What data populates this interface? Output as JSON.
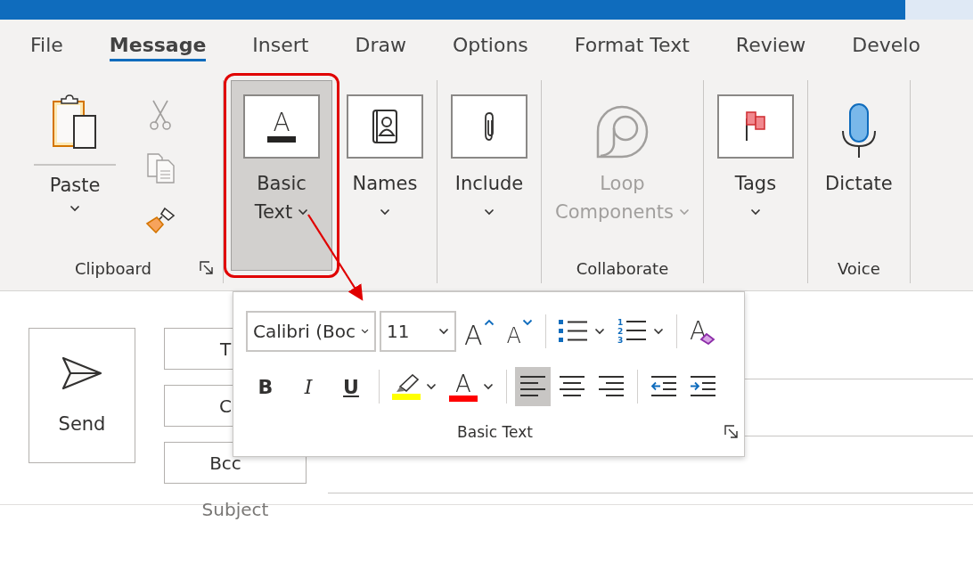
{
  "tabs": [
    {
      "label": "File",
      "selected": false
    },
    {
      "label": "Message",
      "selected": true
    },
    {
      "label": "Insert",
      "selected": false
    },
    {
      "label": "Draw",
      "selected": false
    },
    {
      "label": "Options",
      "selected": false
    },
    {
      "label": "Format Text",
      "selected": false
    },
    {
      "label": "Review",
      "selected": false
    },
    {
      "label": "Develo",
      "selected": false
    }
  ],
  "ribbon": {
    "groups": [
      {
        "kind": "clipboard",
        "label": "Clipboard",
        "launcher": true,
        "paste": "Paste"
      },
      {
        "kind": "large",
        "buttons": [
          {
            "kind": "font",
            "glyph": "A",
            "lines": [
              "Basic",
              "Text"
            ],
            "dropdown": true,
            "selected": true,
            "outlined": true,
            "disabled": false
          },
          {
            "kind": "contacts",
            "lines": [
              "Names"
            ],
            "dropdown": true,
            "selected": false,
            "disabled": false
          }
        ]
      },
      {
        "kind": "large",
        "buttons": [
          {
            "kind": "paperclip",
            "lines": [
              "Include"
            ],
            "dropdown": true,
            "selected": false,
            "disabled": false
          }
        ]
      },
      {
        "kind": "large",
        "label": "Collaborate",
        "buttons": [
          {
            "kind": "loop",
            "lines": [
              "Loop",
              "Components"
            ],
            "dropdown": true,
            "selected": false,
            "disabled": true
          }
        ]
      },
      {
        "kind": "large",
        "buttons": [
          {
            "kind": "flag",
            "lines": [
              "Tags"
            ],
            "dropdown": true,
            "selected": false,
            "disabled": false
          }
        ]
      },
      {
        "kind": "large",
        "label": "Voice",
        "buttons": [
          {
            "kind": "mic",
            "lines": [
              "Dictate"
            ],
            "dropdown": false,
            "selected": false,
            "disabled": false
          }
        ]
      }
    ]
  },
  "basic_text_panel": {
    "title": "Basic Text",
    "launcher": true,
    "font_row": [
      {
        "kind": "font-combo",
        "value": "Calibri (Boc"
      },
      {
        "kind": "size-combo",
        "value": "11"
      },
      {
        "kind": "grow",
        "glyph": "A"
      },
      {
        "kind": "shrink",
        "glyph": "A"
      },
      {
        "kind": "separator"
      },
      {
        "kind": "bullets",
        "dropdown": true
      },
      {
        "kind": "numbering",
        "numbers": [
          "1",
          "2",
          "3"
        ],
        "dropdown": true
      },
      {
        "kind": "separator"
      },
      {
        "kind": "clear",
        "glyph": "A"
      }
    ],
    "format_row": [
      {
        "kind": "text-style",
        "label": "B"
      },
      {
        "kind": "text-style",
        "label": "I"
      },
      {
        "kind": "text-style",
        "label": "U"
      },
      {
        "kind": "separator"
      },
      {
        "kind": "highlight",
        "color": "#ffff00",
        "dropdown": true
      },
      {
        "kind": "font-color",
        "glyph": "A",
        "color": "#ff0000",
        "dropdown": true
      },
      {
        "kind": "separator"
      },
      {
        "kind": "align-left",
        "selected": true
      },
      {
        "kind": "align-center",
        "selected": false
      },
      {
        "kind": "align-right",
        "selected": false
      },
      {
        "kind": "separator"
      },
      {
        "kind": "outdent"
      },
      {
        "kind": "indent"
      }
    ]
  },
  "compose": {
    "send": "Send",
    "recipients": [
      "T",
      "C",
      "Bcc"
    ],
    "subject": "Subject"
  }
}
